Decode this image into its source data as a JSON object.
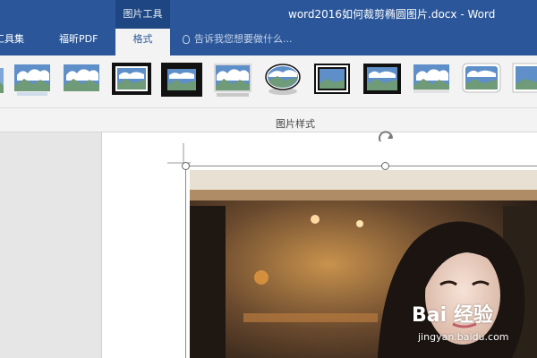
{
  "titlebar": {
    "context_group": "图片工具",
    "document_title": "word2016如何裁剪椭圆图片.docx - Word",
    "tabs": [
      {
        "label": "工具集"
      },
      {
        "label": "福昕PDF"
      }
    ],
    "active_tab": "格式",
    "tell_me_placeholder": "告诉我您想要做什么..."
  },
  "ribbon": {
    "group_label": "图片样式",
    "styles_count_note": "",
    "styles": [
      {
        "name": "picture-style-1"
      },
      {
        "name": "picture-style-2"
      },
      {
        "name": "picture-style-3"
      },
      {
        "name": "picture-style-4"
      },
      {
        "name": "picture-style-5"
      },
      {
        "name": "picture-style-6"
      },
      {
        "name": "picture-style-7"
      },
      {
        "name": "picture-style-8"
      },
      {
        "name": "picture-style-9"
      },
      {
        "name": "picture-style-10"
      },
      {
        "name": "picture-style-11"
      }
    ]
  },
  "watermark": {
    "brand": "Bai 经验",
    "url": "jingyan.baidu.com"
  },
  "colors": {
    "titlebar_blue": "#2b579a",
    "ribbon_bg": "#f3f3f3"
  }
}
